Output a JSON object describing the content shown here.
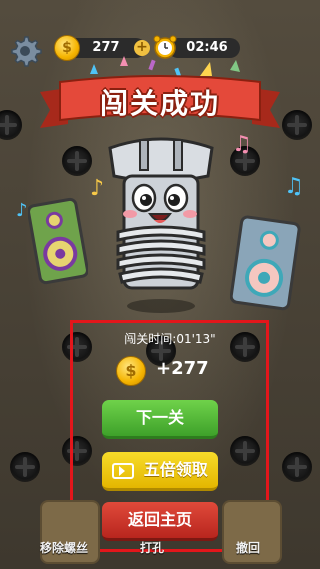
{
  "hud": {
    "coins": "277",
    "timer": "02:46"
  },
  "banner": {
    "title": "闯关成功"
  },
  "result": {
    "time_label": "闯关时间:01'13\"",
    "reward": "+277"
  },
  "buttons": {
    "next": "下一关",
    "multiply": "五倍领取",
    "home": "返回主页"
  },
  "tools": {
    "remove_label": "移除螺丝",
    "hammer_label": "打孔",
    "undo_label": "撤回"
  },
  "colors": {
    "highlight": "#e3161b",
    "next_button": "#4cb534",
    "multiply_button": "#f0c800",
    "home_button": "#c8302a"
  }
}
